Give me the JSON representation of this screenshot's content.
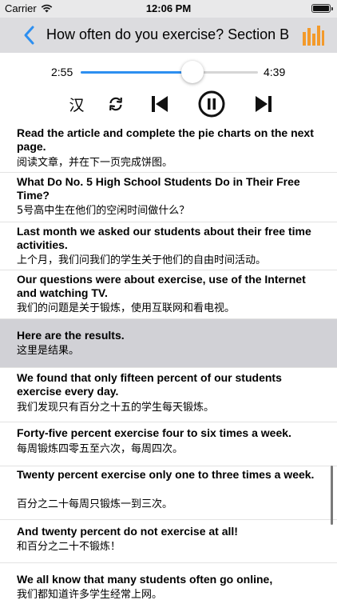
{
  "status_bar": {
    "carrier": "Carrier",
    "time": "12:06 PM"
  },
  "nav": {
    "title": "How often do you exercise? Section B",
    "back_icon": "chevron-left-icon",
    "right_icon": "bar-chart-icon",
    "accent": "#2d8ff0",
    "right_icon_color": "#f39a2b"
  },
  "player": {
    "current_time": "2:55",
    "total_time": "4:39",
    "progress": 0.63,
    "translate_label": "汉",
    "controls": [
      "repeat-icon",
      "previous-icon",
      "pause-icon",
      "next-icon"
    ]
  },
  "sentences": [
    {
      "en": "Read the article and complete the pie charts on the next page.",
      "zh": "阅读文章，并在下一页完成饼图。"
    },
    {
      "en": "What Do No. 5 High School Students Do in Their Free Time?",
      "zh": "5号高中生在他们的空闲时间做什么？"
    },
    {
      "en": "Last month we asked our students about their free time activities.",
      "zh": "上个月，我们问我们的学生关于他们的自由时间活动。"
    },
    {
      "en": "Our questions were about exercise, use of the Internet and watching TV.",
      "zh": "我们的问题是关于锻炼，使用互联网和看电视。"
    },
    {
      "en": "Here are the results.",
      "zh": "这里是结果。"
    },
    {
      "en": "We found that only fifteen percent of our students exercise every day.",
      "zh": "我们发现只有百分之十五的学生每天锻炼。"
    },
    {
      "en": "Forty-five percent exercise four to six times a week.",
      "zh": "每周锻炼四零五至六次，每周四次。"
    },
    {
      "en": "Twenty percent exercise only one to three times a week.",
      "zh": "百分之二十每周只锻炼一到三次。"
    },
    {
      "en": "And twenty percent do not exercise at all!",
      "zh": "和百分之二十不锻炼！"
    },
    {
      "en": "We all know that many students often go online,",
      "zh": "我们都知道许多学生经常上网。"
    }
  ]
}
